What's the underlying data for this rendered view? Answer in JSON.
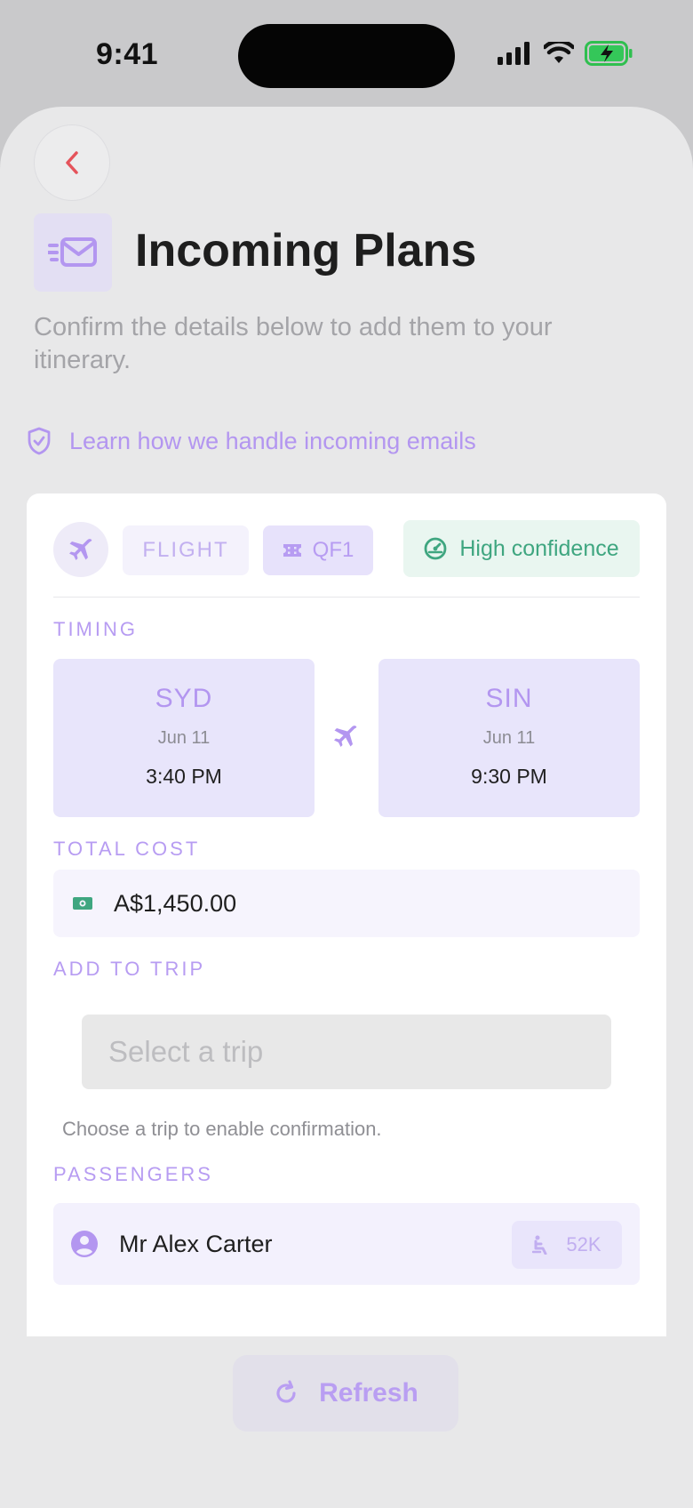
{
  "status_bar": {
    "time": "9:41"
  },
  "header": {
    "title": "Incoming Plans",
    "subtitle": "Confirm the details below to add them to your itinerary.",
    "learn_link": "Learn how we handle incoming emails"
  },
  "booking": {
    "type_label": "FLIGHT",
    "flight_number": "QF1",
    "confidence": "High confidence",
    "timing_label": "TIMING",
    "departure": {
      "code": "SYD",
      "date": "Jun 11",
      "time": "3:40 PM"
    },
    "arrival": {
      "code": "SIN",
      "date": "Jun 11",
      "time": "9:30 PM"
    },
    "cost_label": "TOTAL COST",
    "cost_value": "A$1,450.00",
    "trip_label": "ADD TO TRIP",
    "trip_placeholder": "Select a trip",
    "trip_hint": "Choose a trip to enable confirmation.",
    "passengers_label": "PASSENGERS",
    "passengers": [
      {
        "name": "Mr Alex Carter",
        "seat": "52K"
      }
    ]
  },
  "footer": {
    "refresh_label": "Refresh"
  },
  "colors": {
    "accent": "#b396f0",
    "confidence": "#3fa680",
    "back_arrow": "#e5535b"
  },
  "icons": [
    "back-chevron-icon",
    "mail-icon",
    "shield-check-icon",
    "plane-icon",
    "ticket-icon",
    "gauge-icon",
    "cash-icon",
    "user-circle-icon",
    "seat-icon",
    "refresh-icon"
  ]
}
